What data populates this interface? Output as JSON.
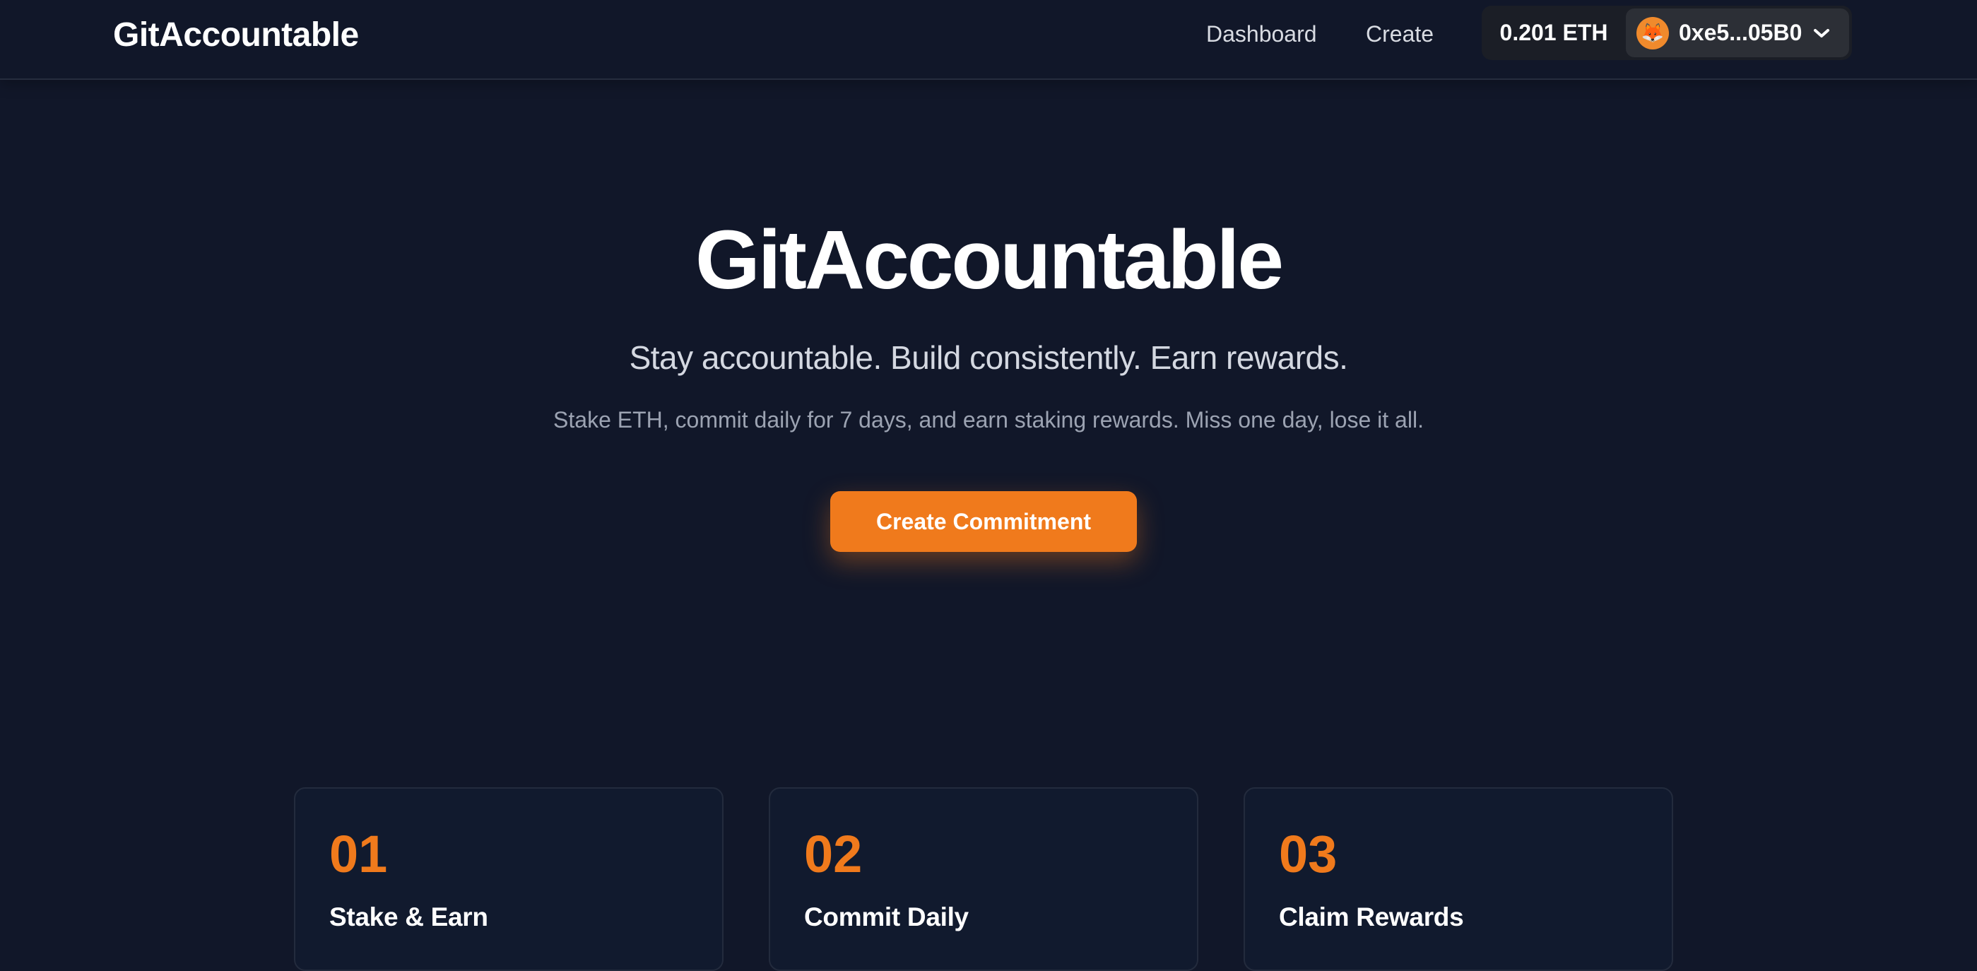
{
  "header": {
    "brand": "GitAccountable",
    "nav": {
      "dashboard": "Dashboard",
      "create": "Create"
    },
    "wallet": {
      "balance": "0.201 ETH",
      "address": "0xe5...05B0",
      "avatar_icon": "fox-icon",
      "dropdown_icon": "chevron-down-icon"
    }
  },
  "hero": {
    "title": "GitAccountable",
    "tagline": "Stay accountable. Build consistently. Earn rewards.",
    "description": "Stake ETH, commit daily for 7 days, and earn staking rewards. Miss one day, lose it all.",
    "cta_label": "Create Commitment"
  },
  "steps": [
    {
      "number": "01",
      "title": "Stake & Earn"
    },
    {
      "number": "02",
      "title": "Commit Daily"
    },
    {
      "number": "03",
      "title": "Claim Rewards"
    }
  ],
  "colors": {
    "background": "#111729",
    "accent": "#f07a1c",
    "text_primary": "#ffffff",
    "text_secondary": "#9ca3b2"
  }
}
